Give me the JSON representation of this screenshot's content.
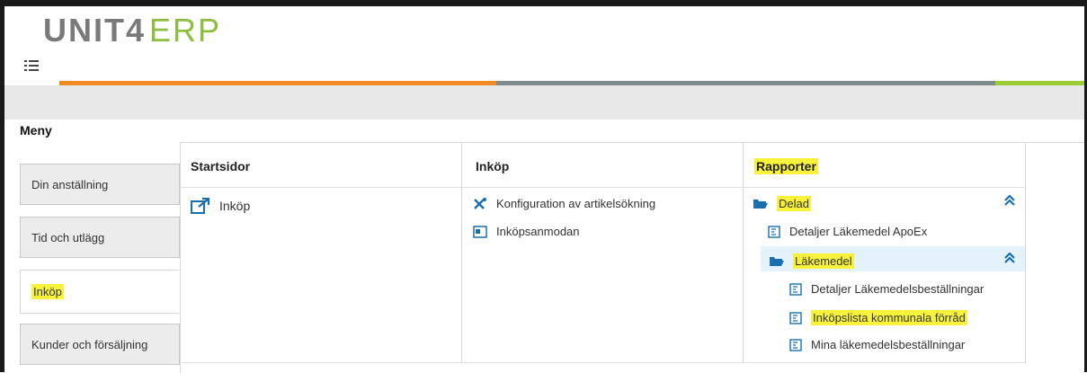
{
  "app": {
    "brand": "UNIT4",
    "product": "ERP"
  },
  "menu": {
    "title": "Meny",
    "tabs": [
      {
        "label": "Din anställning"
      },
      {
        "label": "Tid och utlägg"
      },
      {
        "label": "Inköp"
      },
      {
        "label": "Kunder och försäljning"
      }
    ]
  },
  "columns": {
    "startsidor": {
      "header": "Startsidor",
      "items": [
        {
          "label": "Inköp",
          "icon": "open-external-icon"
        }
      ]
    },
    "inkop": {
      "header": "Inköp",
      "items": [
        {
          "label": "Konfiguration av artikelsökning",
          "icon": "tools-icon"
        },
        {
          "label": "Inköpsanmodan",
          "icon": "form-icon"
        }
      ]
    },
    "rapporter": {
      "header": "Rapporter",
      "folder_delad": "Delad",
      "report_apoex": "Detaljer Läkemedel ApoEx",
      "folder_lakemedel": "Läkemedel",
      "reports": [
        {
          "label": "Detaljer Läkemedelsbeställningar"
        },
        {
          "label": "Inköpslista kommunala förråd"
        },
        {
          "label": "Mina läkemedelsbeställningar"
        }
      ]
    }
  },
  "colors": {
    "highlight": "#f8f33a",
    "accent_blue": "#1a6fae",
    "bar_orange": "#f08a24",
    "bar_gray": "#7f8a8d",
    "bar_green": "#9acd32"
  }
}
